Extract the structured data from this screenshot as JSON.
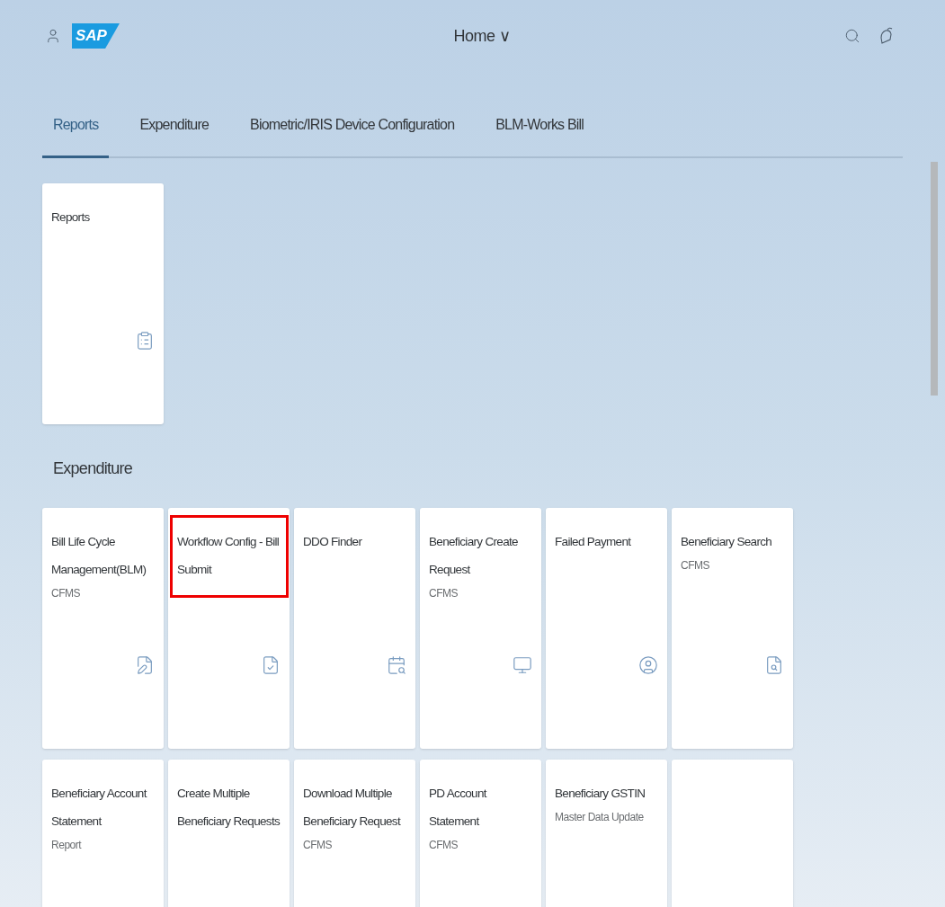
{
  "header": {
    "logo": "SAP",
    "title": "Home ∨"
  },
  "tabs": [
    {
      "label": "Reports",
      "selected": true
    },
    {
      "label": "Expenditure",
      "selected": false
    },
    {
      "label": "Biometric/IRIS Device Configuration",
      "selected": false
    },
    {
      "label": "BLM-Works Bill",
      "selected": false
    }
  ],
  "sections": [
    {
      "tiles": [
        {
          "title": "Reports",
          "highlighted": false
        }
      ]
    },
    {
      "title": "Expenditure",
      "tiles": [
        {
          "title": "Bill Life Cycle Management(BLM)",
          "subtitle": "CFMS",
          "highlighted": false
        },
        {
          "title": "Workflow Config - Bill Submit",
          "highlighted": true
        },
        {
          "title": "DDO Finder",
          "highlighted": false
        },
        {
          "title": "Beneficiary Create Request",
          "subtitle": "CFMS",
          "highlighted": false
        },
        {
          "title": "Failed Payment",
          "highlighted": false
        },
        {
          "title": "Beneficiary Search",
          "subtitle": "CFMS",
          "highlighted": false
        },
        {
          "title": "Beneficiary Account Statement",
          "subtitle": "Report",
          "highlighted": false
        },
        {
          "title": "Create Multiple Beneficiary Requests",
          "highlighted": false
        },
        {
          "title": "Download Multiple Beneficiary Request",
          "subtitle": "CFMS",
          "highlighted": false
        },
        {
          "title": "PD Account Statement",
          "subtitle": "CFMS",
          "highlighted": false
        },
        {
          "title": "Beneficiary GSTIN",
          "subtitle": "Master Data Update",
          "highlighted": false
        },
        {
          "highlighted": false
        }
      ]
    }
  ]
}
